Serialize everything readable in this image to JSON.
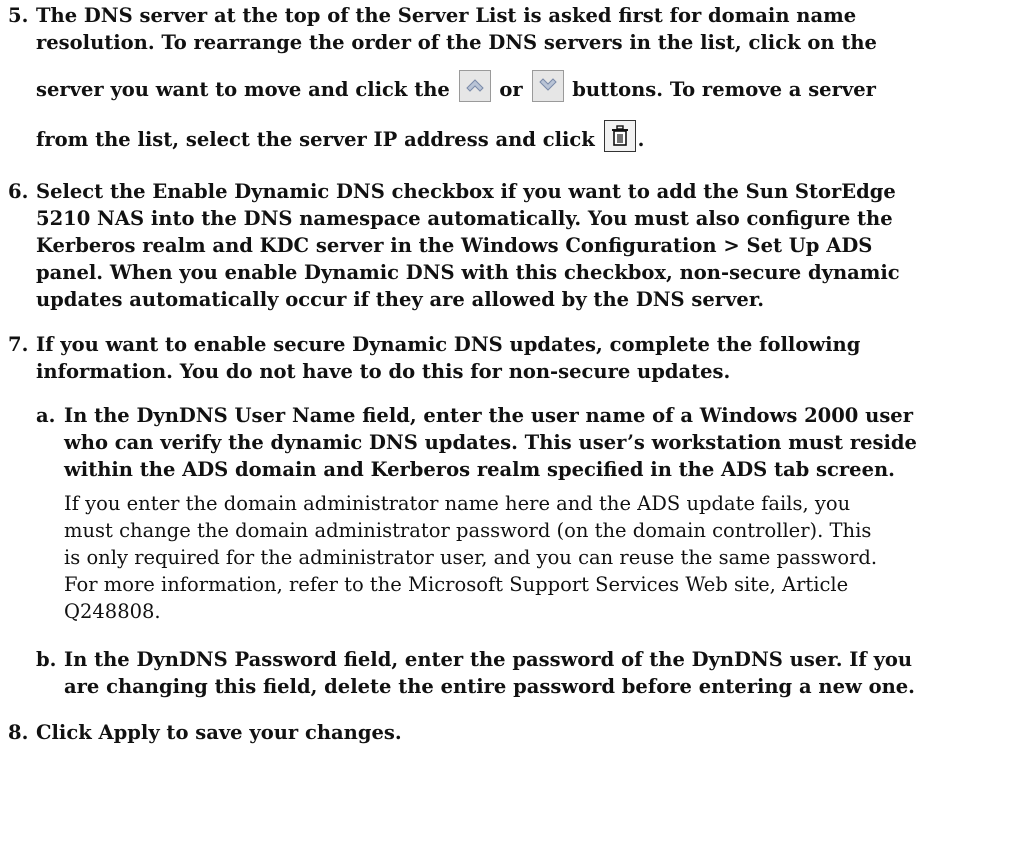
{
  "step5": {
    "num": "5.",
    "l1": "The DNS server at the top of the Server List is asked first for domain name",
    "l2": "resolution. To rearrange the order of the DNS servers in the list, click on the",
    "l3a": "server you want to move and click the",
    "l3b": "or",
    "l3c": "buttons. To remove a server",
    "l4a": "from the list, select the server IP address and click",
    "l4b": "."
  },
  "step6": {
    "num": "6.",
    "l1": "Select the Enable Dynamic DNS checkbox if you want to add the Sun StorEdge",
    "l2": "5210 NAS into the DNS namespace automatically. You must also configure the",
    "l3": "Kerberos realm and KDC server in the Windows Configuration > Set Up ADS",
    "l4": "panel. When you enable Dynamic DNS with this checkbox, non-secure dynamic",
    "l5": "updates automatically occur if they are allowed by the DNS server."
  },
  "step7": {
    "num": "7.",
    "l1": "If you want to enable secure Dynamic DNS updates, complete the following",
    "l2": "information. You do not have to do this for non-secure updates."
  },
  "sub_a": {
    "num": "a.",
    "l1": "In the DynDNS User Name field, enter the user name of a Windows 2000 user",
    "l2": "who can verify the dynamic DNS updates. This user’s workstation must reside",
    "l3": "within the ADS domain and Kerberos realm specified in the ADS tab screen.",
    "p1": "If you enter the domain administrator name here and the ADS update fails, you",
    "p2": "must change the domain administrator password (on the domain controller). This",
    "p3": "is only required for the administrator user, and you can reuse the same password.",
    "p4": "For more information, refer to the Microsoft Support Services Web site, Article",
    "p5": "Q248808."
  },
  "sub_b": {
    "num": "b.",
    "l1": "In the DynDNS Password field, enter the password of the DynDNS user. If you",
    "l2": "are changing this field, delete the entire password before entering a new one."
  },
  "step8": {
    "num": "8.",
    "l1": "Click Apply to save your changes."
  },
  "icons": {
    "up": "chevron-up-icon",
    "down": "chevron-down-icon",
    "trash": "trash-icon"
  }
}
